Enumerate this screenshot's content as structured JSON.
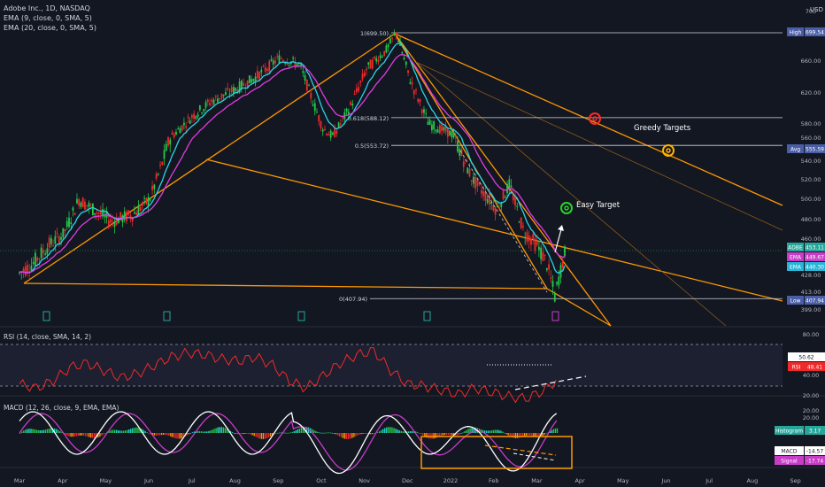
{
  "header": {
    "title": "Adobe Inc., 1D, NASDAQ",
    "ema9": "EMA (9, close, 0, SMA, 5)",
    "ema20": "EMA (20, close, 0, SMA, 5)",
    "currency": "USD"
  },
  "colors": {
    "bg": "#131722",
    "up": "#26c94a",
    "down": "#ef2b2b",
    "ema9": "#29d4e6",
    "ema20": "#e03ce0",
    "fib": "#d1d4dc",
    "pitchfork": "#ff9800",
    "rsi": "#f02a2a",
    "macd": "#ffffff",
    "signal": "#c83cc8",
    "green_target": "#2bd12b",
    "red_target": "#ff2a2a",
    "yellow_target": "#ffb300"
  },
  "chart_data": [
    {
      "type": "candlestick",
      "name": "price",
      "y_ticks": [
        700,
        660.0,
        620.0,
        580.0,
        560.0,
        540.0,
        520.0,
        500.0,
        480.0,
        460.0,
        428.0,
        413.0,
        399.0
      ],
      "y_tick_labels": [
        "700",
        "660.00",
        "620.00",
        "580.00",
        "560.00",
        "540.00",
        "520.00",
        "500.00",
        "480.00",
        "460.00",
        "428.00",
        "413.00",
        "399.00"
      ],
      "x_ticks": [
        "Mar",
        "Apr",
        "May",
        "Jun",
        "Jul",
        "Aug",
        "Sep",
        "Oct",
        "Nov",
        "Dec",
        "2022",
        "Feb",
        "Mar",
        "Apr",
        "May",
        "Jun",
        "Jul",
        "Aug",
        "Sep"
      ],
      "fib_levels": [
        {
          "label": "1(699.50)",
          "value": 699.5
        },
        {
          "label": "0.618(588.12)",
          "value": 588.12
        },
        {
          "label": "0.5(553.72)",
          "value": 553.72
        },
        {
          "label": "0(407.94)",
          "value": 407.94
        }
      ],
      "price_tags": [
        {
          "label": "High",
          "value": "699.54"
        },
        {
          "label": "Avg",
          "value": "555.59"
        },
        {
          "label": "ADBE",
          "value": "453.11"
        },
        {
          "label": "EMA",
          "value": "449.67"
        },
        {
          "label": "EMA",
          "value": "440.30"
        },
        {
          "label": "Low",
          "value": "407.94"
        }
      ],
      "annotations": [
        "Greedy Targets",
        "Easy Target"
      ],
      "close_path": [
        [
          "2021-03-01",
          430
        ],
        [
          "2021-03-10",
          438
        ],
        [
          "2021-03-22",
          455
        ],
        [
          "2021-04-01",
          465
        ],
        [
          "2021-04-12",
          500
        ],
        [
          "2021-04-20",
          492
        ],
        [
          "2021-05-05",
          478
        ],
        [
          "2021-05-20",
          485
        ],
        [
          "2021-06-01",
          500
        ],
        [
          "2021-06-15",
          560
        ],
        [
          "2021-07-01",
          590
        ],
        [
          "2021-07-15",
          610
        ],
        [
          "2021-08-01",
          625
        ],
        [
          "2021-08-15",
          640
        ],
        [
          "2021-09-01",
          665
        ],
        [
          "2021-09-15",
          655
        ],
        [
          "2021-10-01",
          575
        ],
        [
          "2021-10-08",
          562
        ],
        [
          "2021-10-20",
          600
        ],
        [
          "2021-11-01",
          650
        ],
        [
          "2021-11-15",
          675
        ],
        [
          "2021-11-22",
          699.5
        ],
        [
          "2021-12-01",
          640
        ],
        [
          "2021-12-15",
          580
        ],
        [
          "2022-01-01",
          565
        ],
        [
          "2022-01-15",
          520
        ],
        [
          "2022-02-01",
          490
        ],
        [
          "2022-02-10",
          515
        ],
        [
          "2022-02-20",
          468
        ],
        [
          "2022-03-01",
          455
        ],
        [
          "2022-03-08",
          440
        ],
        [
          "2022-03-14",
          410
        ],
        [
          "2022-03-22",
          453.11
        ]
      ]
    },
    {
      "type": "line",
      "name": "rsi",
      "title": "RSI (14, close, SMA, 14, 2)",
      "y_ticks": [
        80.0,
        40.0,
        20.0
      ],
      "y_tick_labels": [
        "80.00",
        "40.00",
        "20.00"
      ],
      "tags": [
        {
          "label": "",
          "value": "50.62"
        },
        {
          "label": "RSI",
          "value": "48.41"
        }
      ],
      "values": [
        42,
        38,
        45,
        58,
        62,
        55,
        48,
        52,
        60,
        68,
        72,
        70,
        66,
        64,
        68,
        60,
        45,
        38,
        50,
        62,
        70,
        74,
        55,
        42,
        40,
        36,
        32,
        38,
        34,
        30,
        28,
        35,
        48
      ]
    },
    {
      "type": "bar",
      "name": "macd",
      "title": "MACD (12, 26, close, 9, EMA, EMA)",
      "tags": [
        {
          "label": "Histogram",
          "value": "3.17"
        },
        {
          "label": "MACD",
          "value": "-14.57"
        },
        {
          "label": "Signal",
          "value": "-17.74"
        }
      ]
    }
  ]
}
